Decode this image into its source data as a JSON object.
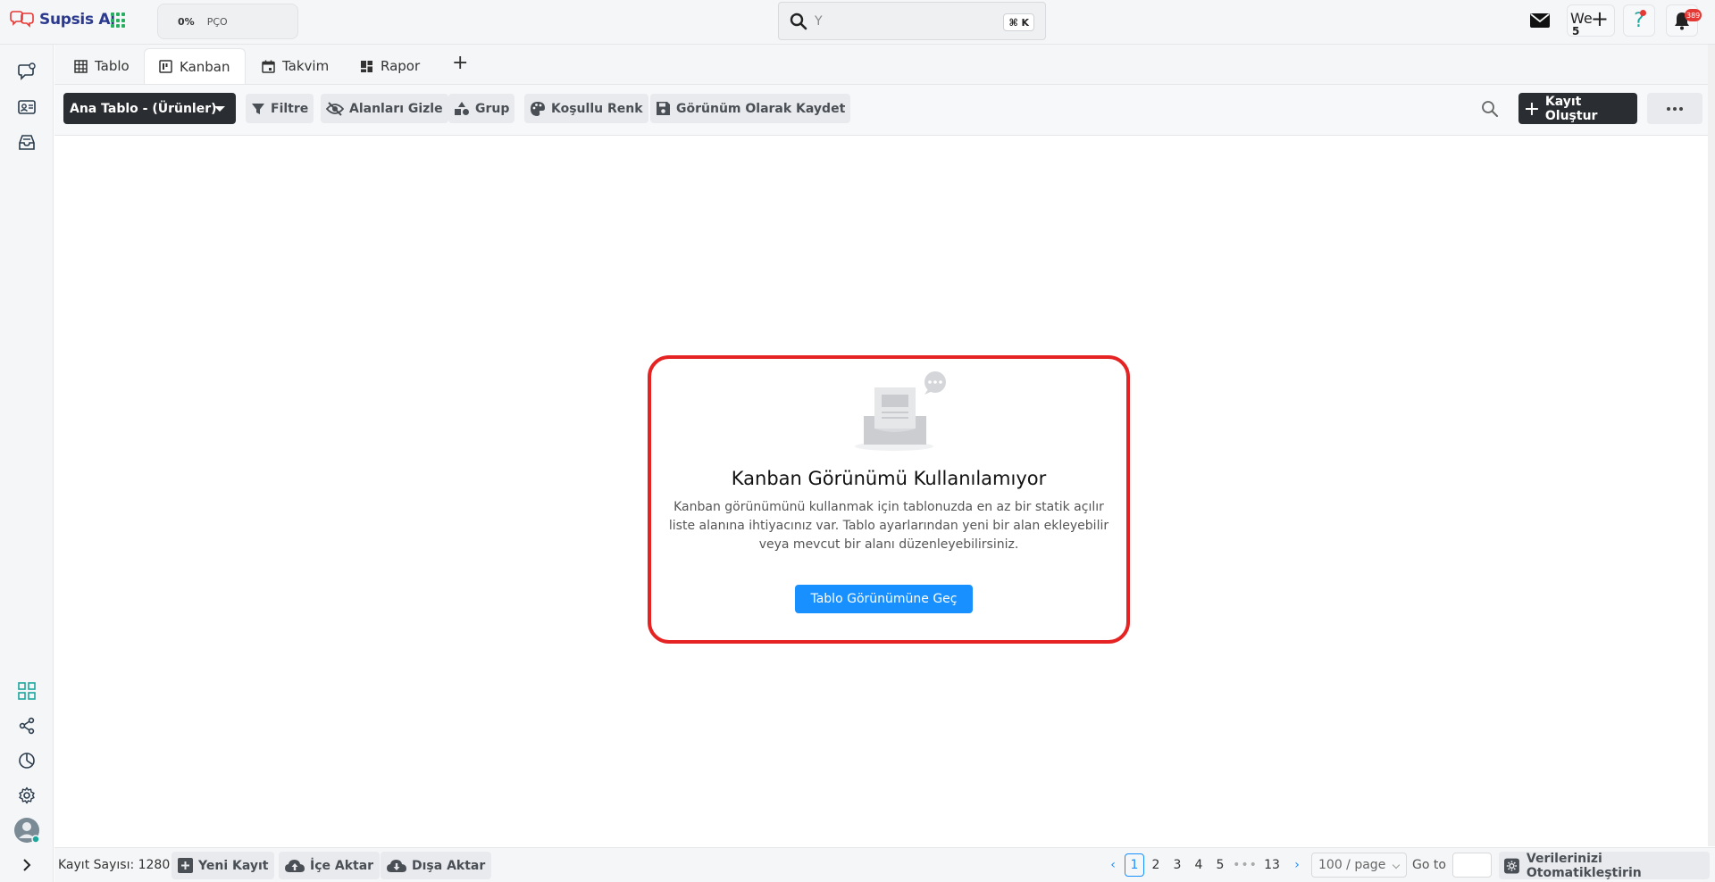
{
  "app": {
    "name": "Supsis Ai"
  },
  "topbar": {
    "progress_percent": "0%",
    "progress_label": "PÇO",
    "search_value": "Y",
    "search_shortcut": "⌘ K",
    "we_label": "We",
    "we_count": "5",
    "notifications_count": "389",
    "colors": {
      "brand": "#2b3a8f",
      "help": "#1ba79c",
      "badge": "#e53935"
    }
  },
  "tabs": [
    {
      "label": "Tablo",
      "icon": "table-icon",
      "active": false
    },
    {
      "label": "Kanban",
      "icon": "kanban-icon",
      "active": true
    },
    {
      "label": "Takvim",
      "icon": "calendar-icon",
      "active": false
    },
    {
      "label": "Rapor",
      "icon": "dashboard-icon",
      "active": false
    }
  ],
  "toolbar": {
    "table_select": "Ana Tablo - (Ürünler)",
    "filter": "Filtre",
    "hide_fields": "Alanları Gizle",
    "group": "Grup",
    "conditional_color": "Koşullu Renk",
    "save_view": "Görünüm Olarak Kaydet",
    "create_record": "Kayıt Oluştur"
  },
  "empty_state": {
    "title": "Kanban Görünümü Kullanılamıyor",
    "description": "Kanban görünümünü kullanmak için tablonuzda en az bir statik açılır liste alanına ihtiyacınız var. Tablo ayarlarından yeni bir alan ekleyebilir veya mevcut bir alanı düzenleyebilirsiniz.",
    "button": "Tablo Görünümüne Geç",
    "highlight_color": "#e52323"
  },
  "footer": {
    "record_count": "Kayıt Sayısı: 1280",
    "new_record": "Yeni Kayıt",
    "import": "İçe Aktar",
    "export": "Dışa Aktar",
    "pages": [
      "1",
      "2",
      "3",
      "4",
      "5"
    ],
    "dots": "•••",
    "last_page": "13",
    "current_page": "1",
    "page_size": "100 / page",
    "goto_label": "Go to",
    "automate": "Verilerinizi Otomatikleştirin"
  }
}
